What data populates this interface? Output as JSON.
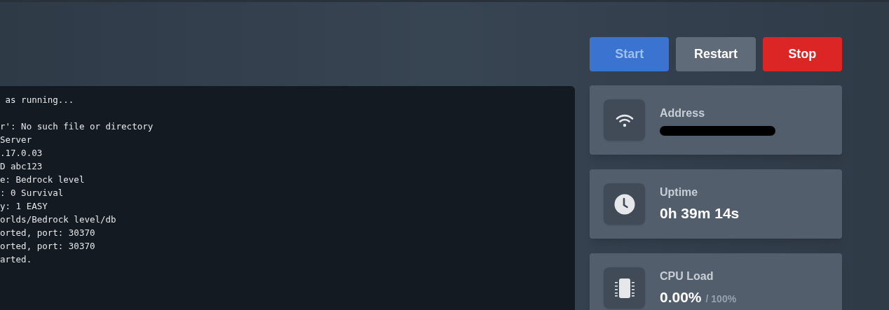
{
  "console": {
    "blocks": [
      {
        "lines": [
          " as running..."
        ]
      },
      {
        "lines": [
          "r': No such file or directory",
          "Server",
          ".17.0.03",
          "D abc123",
          "e: Bedrock level",
          ": 0 Survival",
          "y: 1 EASY",
          "orlds/Bedrock level/db",
          "orted, port: 30370",
          "orted, port: 30370",
          "arted."
        ]
      }
    ]
  },
  "controls": [
    {
      "kind": "start",
      "label": "Start",
      "disabled": true
    },
    {
      "kind": "restart",
      "label": "Restart",
      "disabled": false
    },
    {
      "kind": "stop",
      "label": "Stop",
      "disabled": false
    }
  ],
  "stats": [
    {
      "kind": "network",
      "label": "Address",
      "redacted": true
    },
    {
      "kind": "clock",
      "label": "Uptime",
      "value": "0h 39m 14s",
      "redacted": false
    },
    {
      "kind": "chip",
      "label": "CPU Load",
      "value": "0.00%",
      "limit": "/ 100%",
      "redacted": false
    }
  ]
}
